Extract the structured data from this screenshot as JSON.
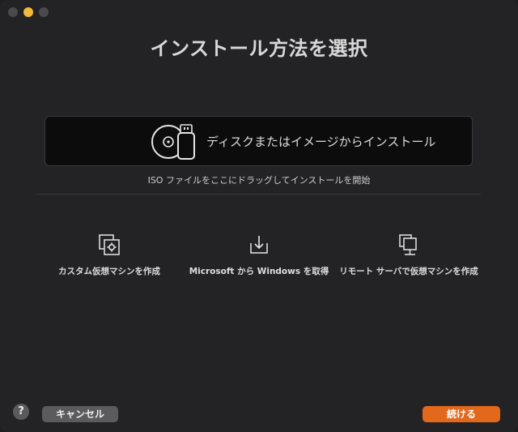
{
  "title": "インストール方法を選択",
  "primary_option": {
    "label": "ディスクまたはイメージからインストール",
    "icon": "disc-usb-icon"
  },
  "hint": "ISO ファイルをここにドラッグしてインストールを開始",
  "options": [
    {
      "label": "カスタム仮想マシンを作成",
      "icon": "custom-vm-icon"
    },
    {
      "label": "Microsoft から Windows を取得",
      "icon": "download-icon"
    },
    {
      "label": "リモート サーバで仮想マシンを作成",
      "icon": "remote-server-icon"
    }
  ],
  "help": {
    "label": "?"
  },
  "buttons": {
    "cancel": "キャンセル",
    "continue": "続ける"
  },
  "colors": {
    "accent": "#e2681b",
    "minimize": "#f6b83c",
    "background": "#232325"
  }
}
